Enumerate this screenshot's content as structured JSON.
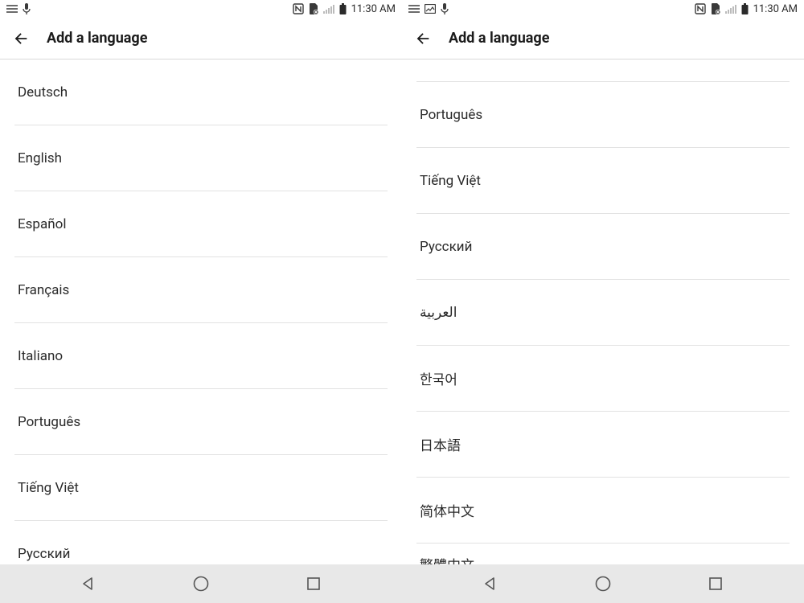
{
  "screens": [
    {
      "status": {
        "time": "11:30 AM",
        "left_icons": [
          "hamburger",
          "mic"
        ],
        "right_icons": [
          "nfc",
          "simx",
          "signal",
          "battery"
        ]
      },
      "title": "Add a language",
      "items": [
        "Deutsch",
        "English",
        "Español",
        "Français",
        "Italiano",
        "Português",
        "Tiếng Việt",
        "Русский"
      ]
    },
    {
      "status": {
        "time": "11:30 AM",
        "left_icons": [
          "hamburger",
          "image",
          "mic"
        ],
        "right_icons": [
          "nfc",
          "simx",
          "signal",
          "battery"
        ]
      },
      "title": "Add a language",
      "top_partial": true,
      "items": [
        "Português",
        "Tiếng Việt",
        "Русский",
        "العربية",
        "한국어",
        "日本語",
        "简体中文"
      ],
      "bottom_partial": "繁體中文"
    }
  ]
}
